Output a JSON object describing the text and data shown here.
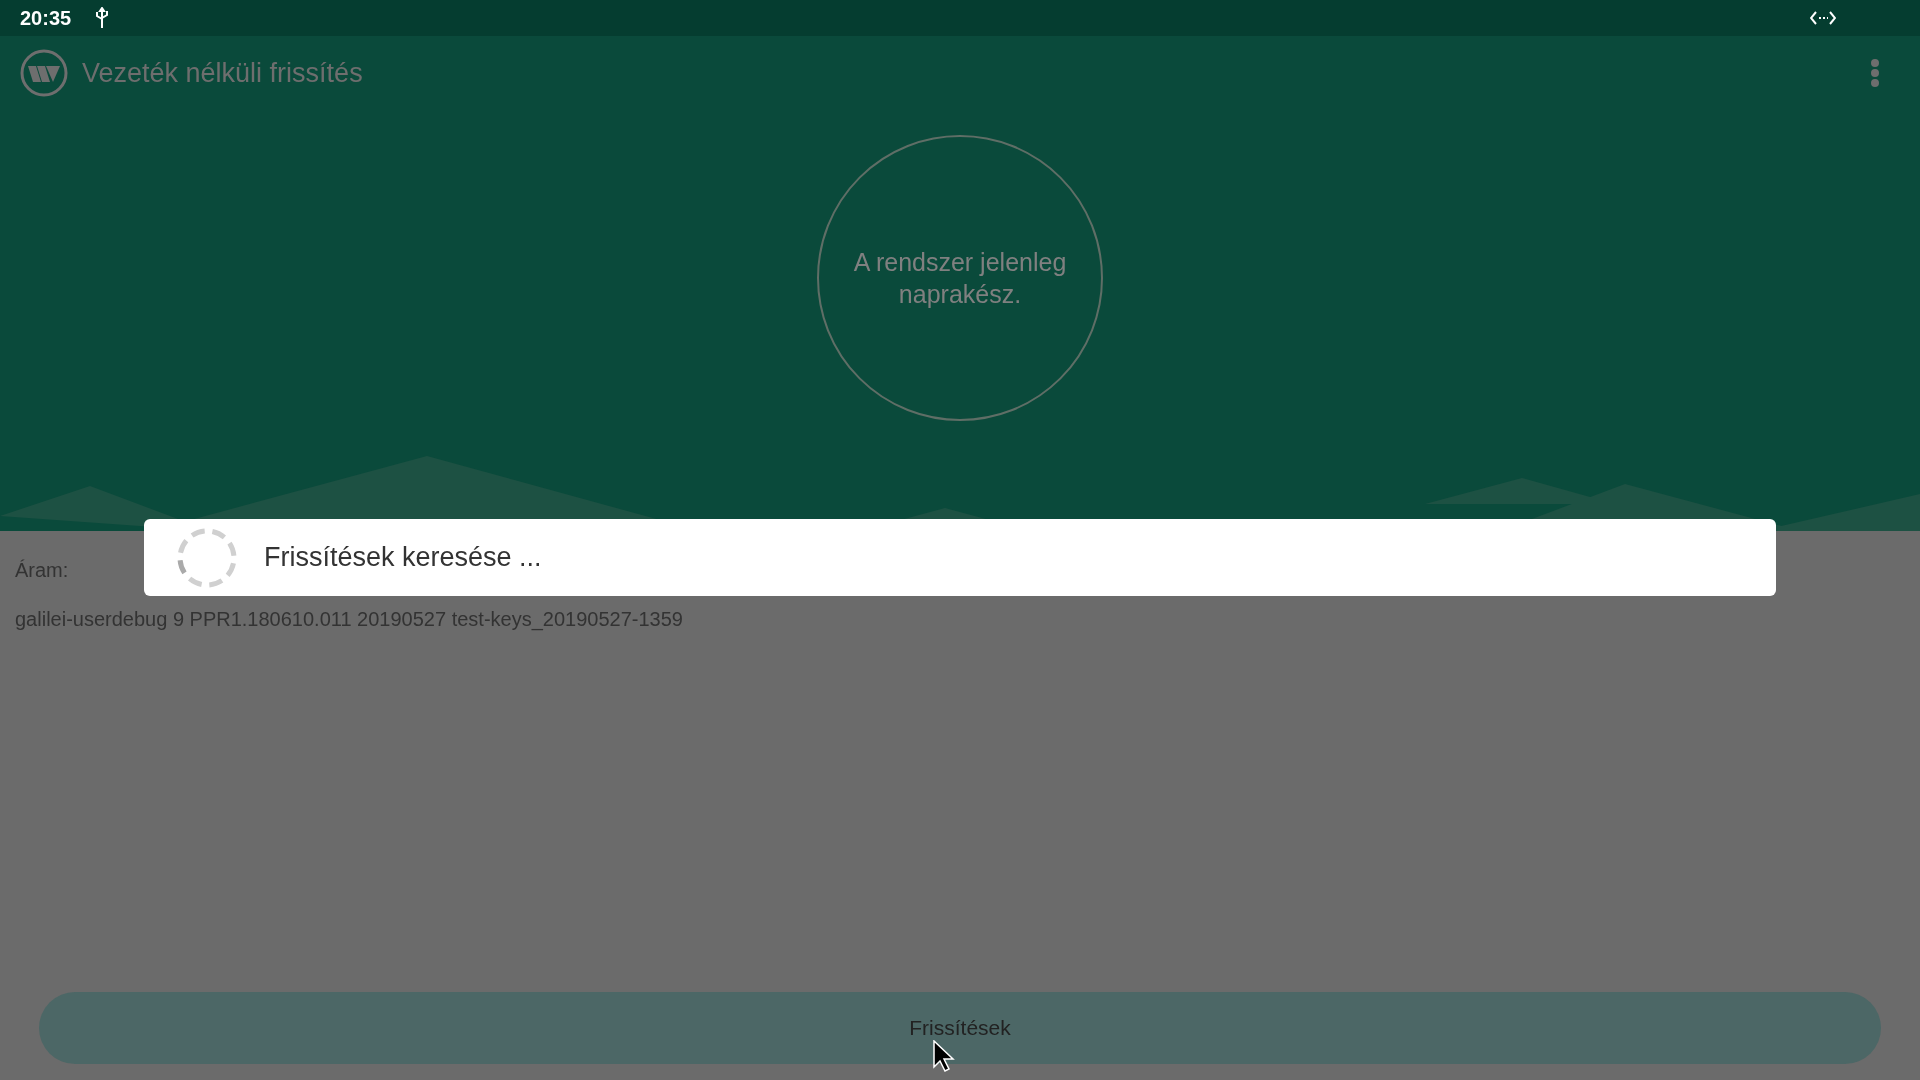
{
  "status_bar": {
    "time": "20:35"
  },
  "app_bar": {
    "title": "Vezeték nélküli frissítés"
  },
  "status_circle": {
    "message": "A rendszer jelenleg naprakész."
  },
  "current": {
    "label": "Áram:",
    "version": "galilei-userdebug 9 PPR1.180610.011 20190527 test-keys_20190527-1359"
  },
  "dialog": {
    "message": "Frissítések keresése ..."
  },
  "update_button": {
    "label": "Frissítések"
  }
}
